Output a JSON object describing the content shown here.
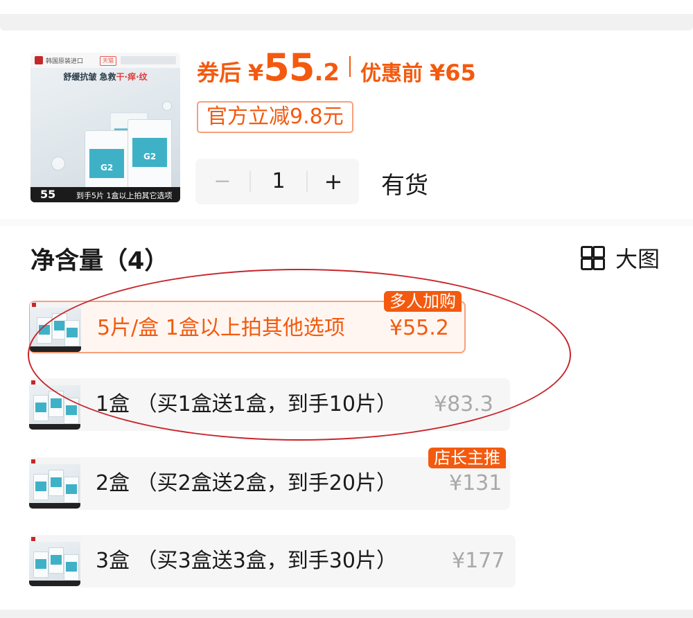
{
  "product": {
    "thumb_brand": "韩国原装进口",
    "thumb_badge": "天猫",
    "thumb_headline_a": "舒缓抗皱 急救",
    "thumb_headline_b": "干·痒·纹",
    "thumb_price": "55",
    "thumb_footer_text": "到手5片 1盒以上拍其它选项"
  },
  "pricing": {
    "after_coupon_label": "券后",
    "currency": "¥",
    "after_coupon_int": "55",
    "after_coupon_dec": ".2",
    "before_label": "优惠前",
    "before_value": "¥65",
    "promo_text": "官方立减9.8元"
  },
  "quantity": {
    "minus": "−",
    "value": "1",
    "plus": "+",
    "stock_status": "有货"
  },
  "spec": {
    "title": "净含量（4）",
    "big_view_label": "大图"
  },
  "options": [
    {
      "label": "5片/盒 1盒以上拍其他选项",
      "price": "¥55.2",
      "tag": "多人加购",
      "selected": true
    },
    {
      "label": "1盒 （买1盒送1盒，到手10片）",
      "price": "¥83.3",
      "tag": "",
      "selected": false
    },
    {
      "label": "2盒 （买2盒送2盒，到手20片）",
      "price": "¥131",
      "tag": "店长主推",
      "selected": false
    },
    {
      "label": "3盒 （买3盒送3盒，到手30片）",
      "price": "¥177",
      "tag": "",
      "selected": false
    }
  ],
  "colors": {
    "accent": "#f35a0f",
    "annotation_circle": "#c7252a",
    "muted_price": "#a8a8a8"
  }
}
